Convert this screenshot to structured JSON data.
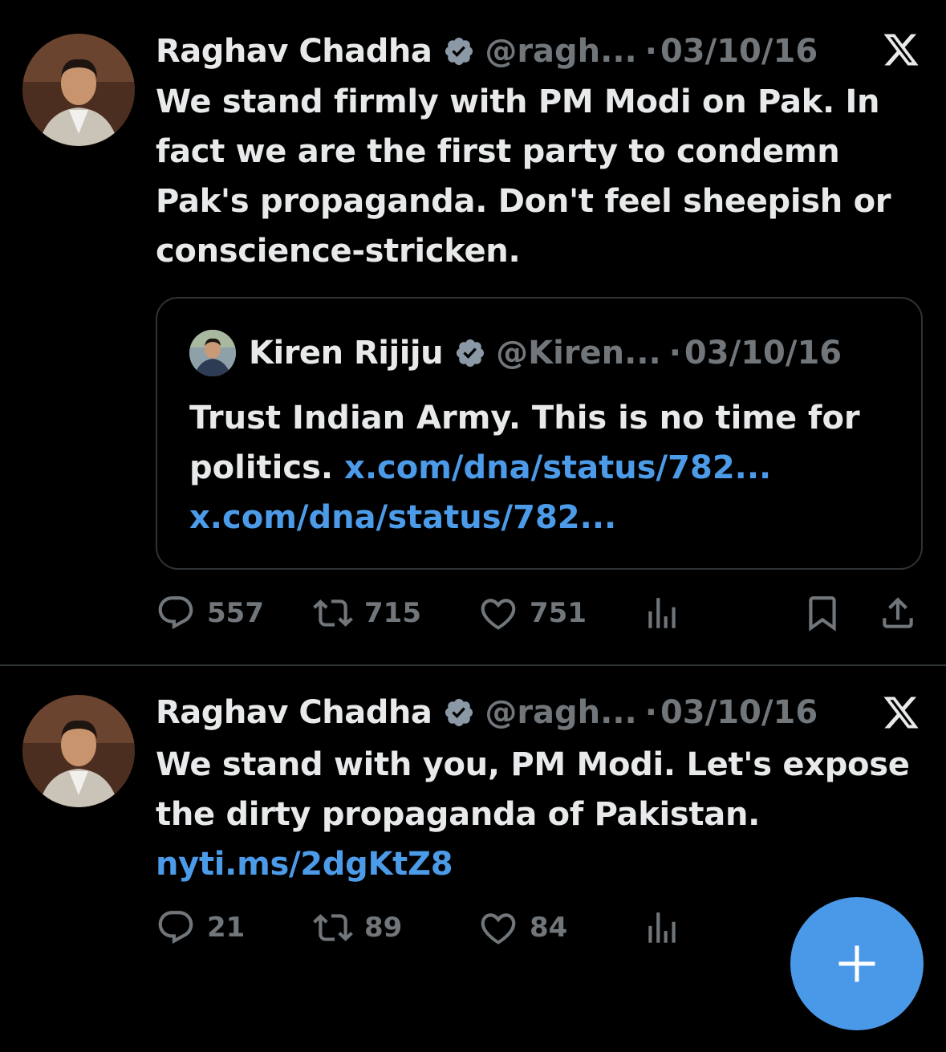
{
  "tweets": [
    {
      "name": "Raghav Chadha",
      "handle": "@ragh...",
      "dot": "·",
      "date": "03/10/16",
      "text": "We stand firmly with PM Modi on Pak. In fact we are the first party to condemn Pak's propaganda. Don't feel sheepish or conscience-stricken.",
      "quote": {
        "name": "Kiren Rijiju",
        "handle": "@Kiren...",
        "dot": "·",
        "date": "03/10/16",
        "text": "Trust Indian Army. This is no time for politics.",
        "link1": "x.com/dna/status/782...",
        "link2": "x.com/dna/status/782..."
      },
      "replies": "557",
      "reposts": "715",
      "likes": "751"
    },
    {
      "name": "Raghav Chadha",
      "handle": "@ragh...",
      "dot": "·",
      "date": "03/10/16",
      "text": "We stand with you, PM Modi. Let's expose the dirty propaganda of Pakistan.",
      "link": "nyti.ms/2dgKtZ8",
      "replies": "21",
      "reposts": "89",
      "likes": "84"
    }
  ],
  "icons": {
    "verified": "verified-badge-icon",
    "x_logo": "x-logo-icon",
    "reply": "reply-icon",
    "repost": "repost-icon",
    "like": "heart-icon",
    "views": "views-icon",
    "bookmark": "bookmark-icon",
    "share": "share-icon",
    "compose": "plus-icon"
  },
  "colors": {
    "background": "#000000",
    "text": "#e7e9ea",
    "muted": "#71767b",
    "link": "#4c9be8",
    "accent": "#4a99e9"
  }
}
